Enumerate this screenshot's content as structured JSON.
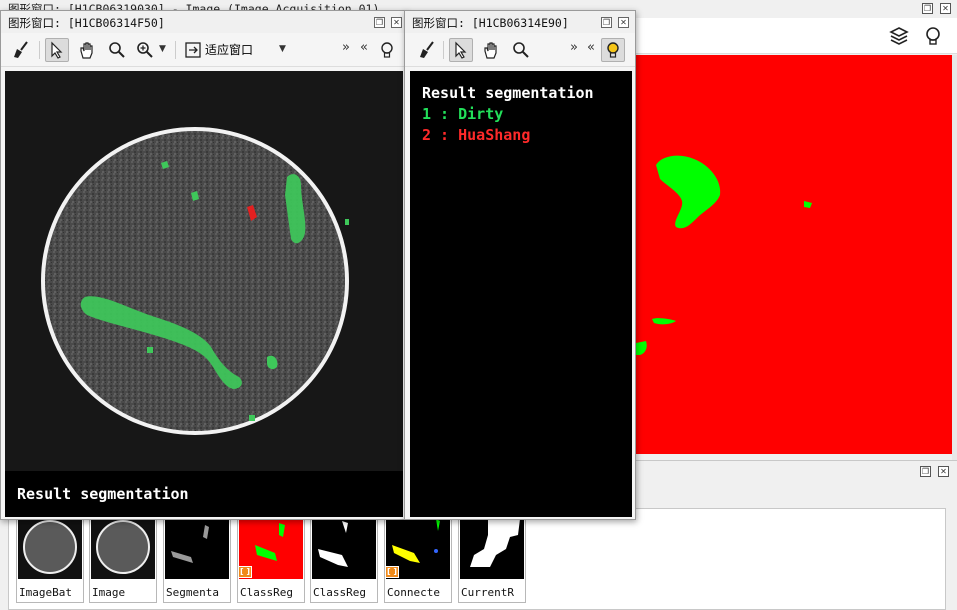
{
  "background_window": {
    "title": "图形窗口: [H1CB06319030] - Image (Image Acquisition 01)"
  },
  "window1": {
    "title": "图形窗口: [H1CB06314F50]",
    "toolbar": {
      "fit_label": "适应窗口",
      "more": "»",
      "less": "«"
    },
    "caption": "Result segmentation"
  },
  "window2": {
    "title": "图形窗口: [H1CB06314E90]",
    "toolbar": {
      "more": "»",
      "less": "«"
    },
    "legend": {
      "heading": "Result segmentation",
      "class1": "1 : Dirty",
      "class2": "2 : HuaShang"
    }
  },
  "colors": {
    "legend_heading": "#ffffff",
    "class1": "#22e05a",
    "class2": "#ff2a2a",
    "region_green": "#00ff00",
    "region_red": "#ff0000"
  },
  "thumbnails": [
    {
      "label": "ImageBat"
    },
    {
      "label": "Image"
    },
    {
      "label": "Segmenta"
    },
    {
      "label": "ClassReg"
    },
    {
      "label": "ClassReg"
    },
    {
      "label": "Connecte"
    },
    {
      "label": "CurrentR"
    }
  ]
}
